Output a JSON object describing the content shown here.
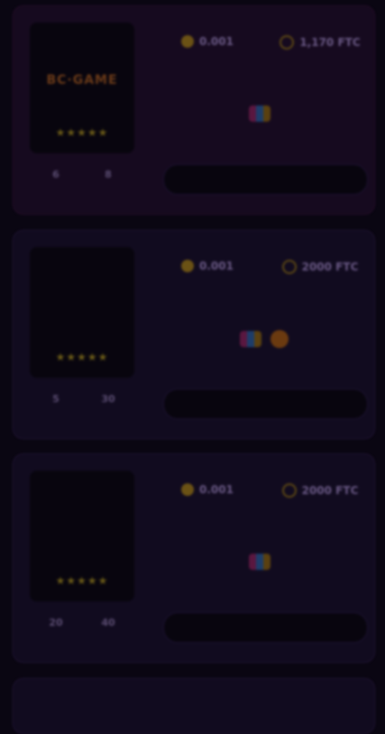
{
  "colors": {
    "background": "#0a0612",
    "card": "#110b1f",
    "card_highlight": "#160a1f",
    "gold": "#6b5215",
    "accent_pink": "#5a1740",
    "accent_green": "#0d5a2a"
  },
  "cards": [
    {
      "logo": "BC·GAME",
      "logo_color": "#6a3a18",
      "stars": "★★★★★",
      "reviews": "",
      "mini_stats": [
        {
          "label": "",
          "value": "6"
        },
        {
          "label": "",
          "value": "8"
        }
      ],
      "min_deposit": {
        "label": "",
        "value": "0.001"
      },
      "max_bonus": {
        "label": "",
        "value": "1,170 FTC"
      },
      "payments_label": "",
      "payments": [
        "visa",
        "mastercard",
        ""
      ],
      "button": "",
      "footer": ""
    },
    {
      "logo": "",
      "logo_color": "#2c2440",
      "stars": "★★★★★",
      "reviews": "",
      "mini_stats": [
        {
          "label": "",
          "value": "5"
        },
        {
          "label": "",
          "value": "30"
        }
      ],
      "min_deposit": {
        "label": "",
        "value": "0.001"
      },
      "max_bonus": {
        "label": "",
        "value": "2000 FTC"
      },
      "payments_label": "",
      "payments": [
        "",
        "mastercard",
        "bitcoin",
        ""
      ],
      "button": "",
      "footer": ""
    },
    {
      "logo": "",
      "logo_color": "#0d5a2a",
      "stars": "★★★★★",
      "reviews": "",
      "mini_stats": [
        {
          "label": "",
          "value": "20"
        },
        {
          "label": "",
          "value": "40"
        }
      ],
      "min_deposit": {
        "label": "",
        "value": "0.001"
      },
      "max_bonus": {
        "label": "",
        "value": "2000 FTC"
      },
      "payments_label": "",
      "payments": [
        "",
        "mastercard",
        "",
        ""
      ],
      "button": "",
      "footer": ""
    }
  ],
  "card4": {
    "min_deposit_label": "",
    "max_bonus_label": ""
  }
}
